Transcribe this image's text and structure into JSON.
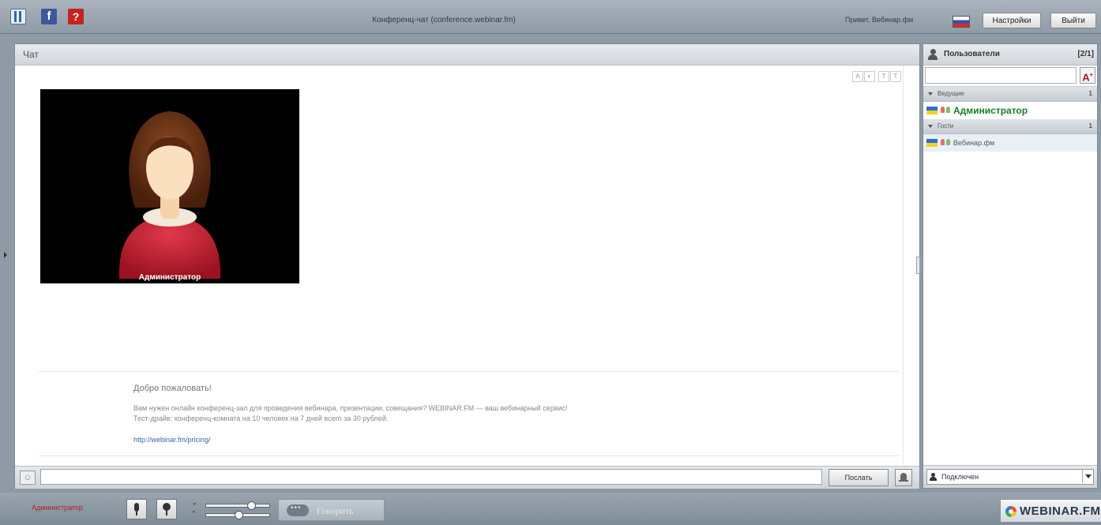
{
  "topbar": {
    "title": "Конференц-чат (conference.webinar.fm)",
    "greeting": "Привет, Вебинар.фм",
    "settings_label": "Настройки",
    "exit_label": "Выйти"
  },
  "chat": {
    "header": "Чат",
    "video_caption": "Администратор",
    "welcome_title": "Добро пожаловать!",
    "welcome_line1": "Вам нужен онлайн конференц-зал для проведения вебинара, презентации, совещания? WEBINAR.FM — ваш вебинарный сервис!",
    "welcome_line2": "Тест-драйв: конференц-комната на 10 человек на 7 дней всего за 30 рублей.",
    "welcome_link": "http://webinar.fm/pricing/",
    "message_value": "",
    "send_label": "Послать"
  },
  "users": {
    "title": "Пользователи",
    "count": "[2/1]",
    "search_value": "",
    "groups": [
      {
        "name": "Ведущие",
        "count": "1",
        "members": [
          "Администратор"
        ]
      },
      {
        "name": "Гости",
        "count": "1",
        "members": [
          "Вебинар.фм"
        ]
      }
    ],
    "status": "Подключен"
  },
  "bottombar": {
    "me": "Администратор",
    "speak_label": "Говорить",
    "logo_text": "WEBINAR.FM"
  },
  "colors": {
    "admin_green": "#1a7b2a",
    "me_red": "#b22222",
    "frame": "#8e9aa5"
  },
  "icons": [
    "layout-icon",
    "facebook-icon",
    "help-icon",
    "ru-flag-icon",
    "users-icon",
    "font-size-icon",
    "ua-flag-icon",
    "mic-icon",
    "camera-icon",
    "speak-icon",
    "bell-icon",
    "emoji-icon"
  ]
}
